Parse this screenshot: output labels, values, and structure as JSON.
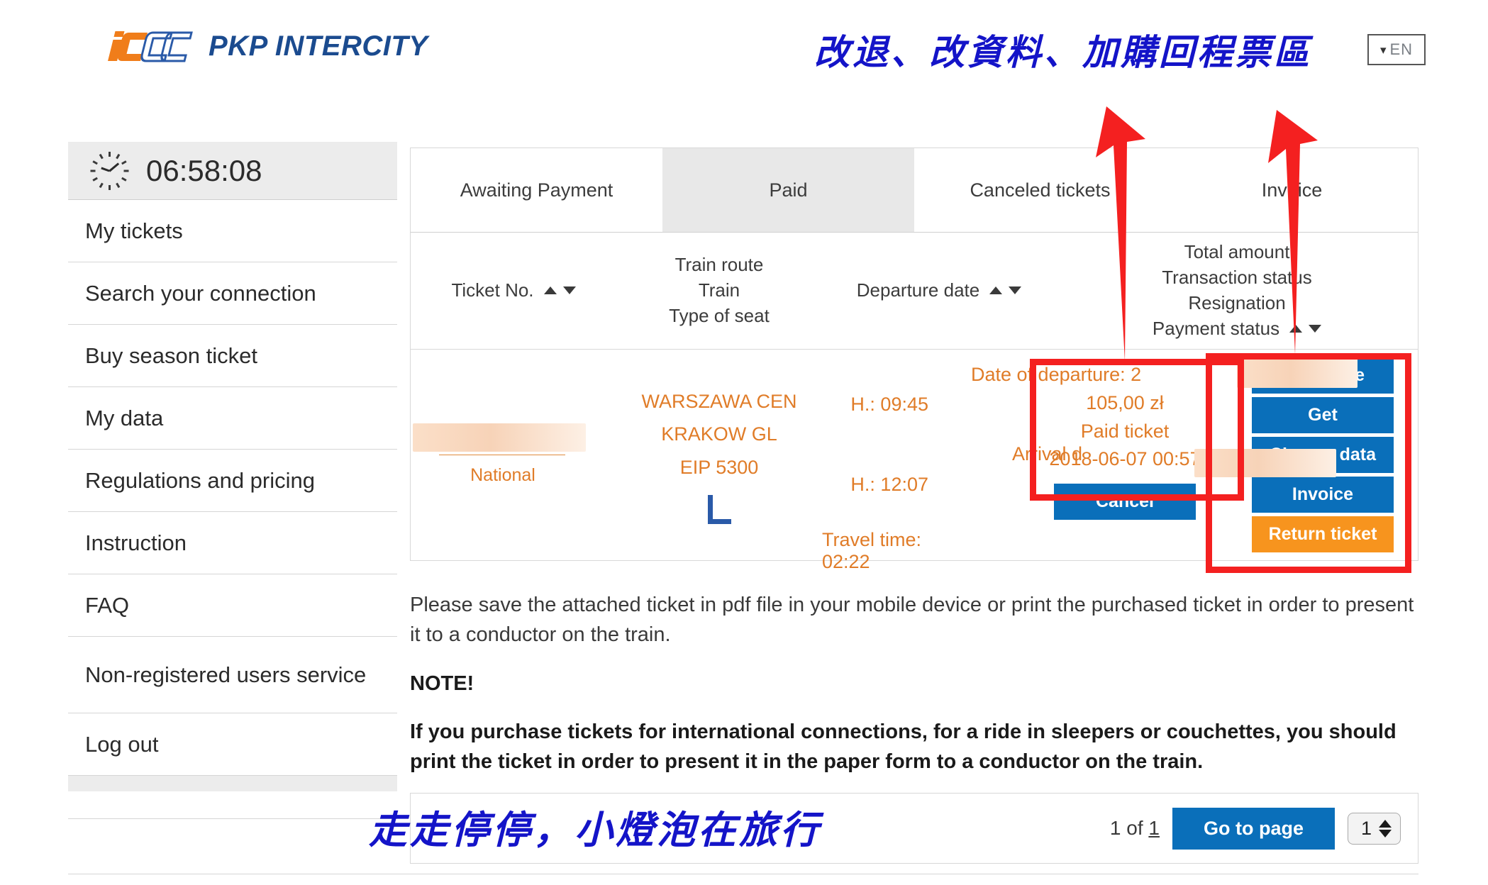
{
  "header": {
    "brand": "PKP INTERCITY",
    "logo_icon": "icc-logo-icon",
    "language": {
      "label": "EN",
      "chevron": "chevron-down-icon"
    }
  },
  "annotations": {
    "top_note": "改退、改資料、加購回程票區",
    "bottom_note": "走走停停，小燈泡在旅行",
    "arrow_color": "#f42020",
    "ink_color": "#1414c8"
  },
  "sidebar": {
    "clock_icon": "clock-icon",
    "clock_time": "06:58:08",
    "items": [
      {
        "label": "My tickets"
      },
      {
        "label": "Search your connection"
      },
      {
        "label": "Buy season ticket"
      },
      {
        "label": "My data"
      },
      {
        "label": "Regulations and pricing"
      },
      {
        "label": "Instruction"
      },
      {
        "label": "FAQ"
      },
      {
        "label": "Non-registered users service"
      },
      {
        "label": "Log out"
      }
    ]
  },
  "main": {
    "tabs": [
      {
        "label": "Awaiting Payment",
        "active": false
      },
      {
        "label": "Paid",
        "active": true
      },
      {
        "label": "Canceled tickets",
        "active": false
      },
      {
        "label": "Invoice",
        "active": false
      }
    ],
    "columns": {
      "ticket_no": "Ticket No.",
      "route_line1": "Train route",
      "route_line2": "Train",
      "route_line3": "Type of seat",
      "departure_date": "Departure date",
      "amount_line1": "Total amount",
      "amount_line2": "Transaction status",
      "amount_line3": "Resignation",
      "amount_line4": "Payment status"
    },
    "sort_icons": {
      "asc": "sort-ascending-icon",
      "desc": "sort-descending-icon"
    },
    "ticket": {
      "ticket_no_redacted": "",
      "category": "National",
      "route_from": "WARSZAWA CEN",
      "route_to": "KRAKOW GL",
      "train": "EIP 5300",
      "seat_icon": "seat-type-icon",
      "departure_label": "Date of departure: 2",
      "departure_time": "H.: 09:45",
      "arrival_label": "Arrival d",
      "arrival_time": "H.: 12:07",
      "travel_time": "Travel time: 02:22",
      "amount": "105,00 zł",
      "transaction_status": "Paid ticket",
      "payment_datetime": "2018-06-07 00:57",
      "cancel_button": "Cancel",
      "actions": [
        {
          "label": "Exchange",
          "style": "blue"
        },
        {
          "label": "Get",
          "style": "blue"
        },
        {
          "label": "Change data",
          "style": "blue"
        },
        {
          "label": "Invoice",
          "style": "blue"
        },
        {
          "label": "Return ticket",
          "style": "orange"
        }
      ]
    }
  },
  "notes": {
    "intro": "Please save the attached ticket in pdf file in your mobile device or print the purchased ticket in order to present it to a conductor on the train.",
    "heading": "NOTE!",
    "body": "If you purchase tickets for international connections, for a ride in sleepers or couchettes, you should print the ticket in order to present it in the paper form to a conductor on the train."
  },
  "pagination": {
    "page_of": "1 of ",
    "total_pages": "1",
    "goto_label": "Go to page",
    "page_value": "1",
    "stepper_up_icon": "stepper-up-icon",
    "stepper_down_icon": "stepper-down-icon"
  },
  "colors": {
    "brand_blue": "#1b4b8f",
    "button_blue": "#0a6fba",
    "orange": "#e07c28",
    "button_orange": "#f7941e",
    "annotation_red": "#f42020",
    "tab_active_bg": "#e8e8e8"
  }
}
